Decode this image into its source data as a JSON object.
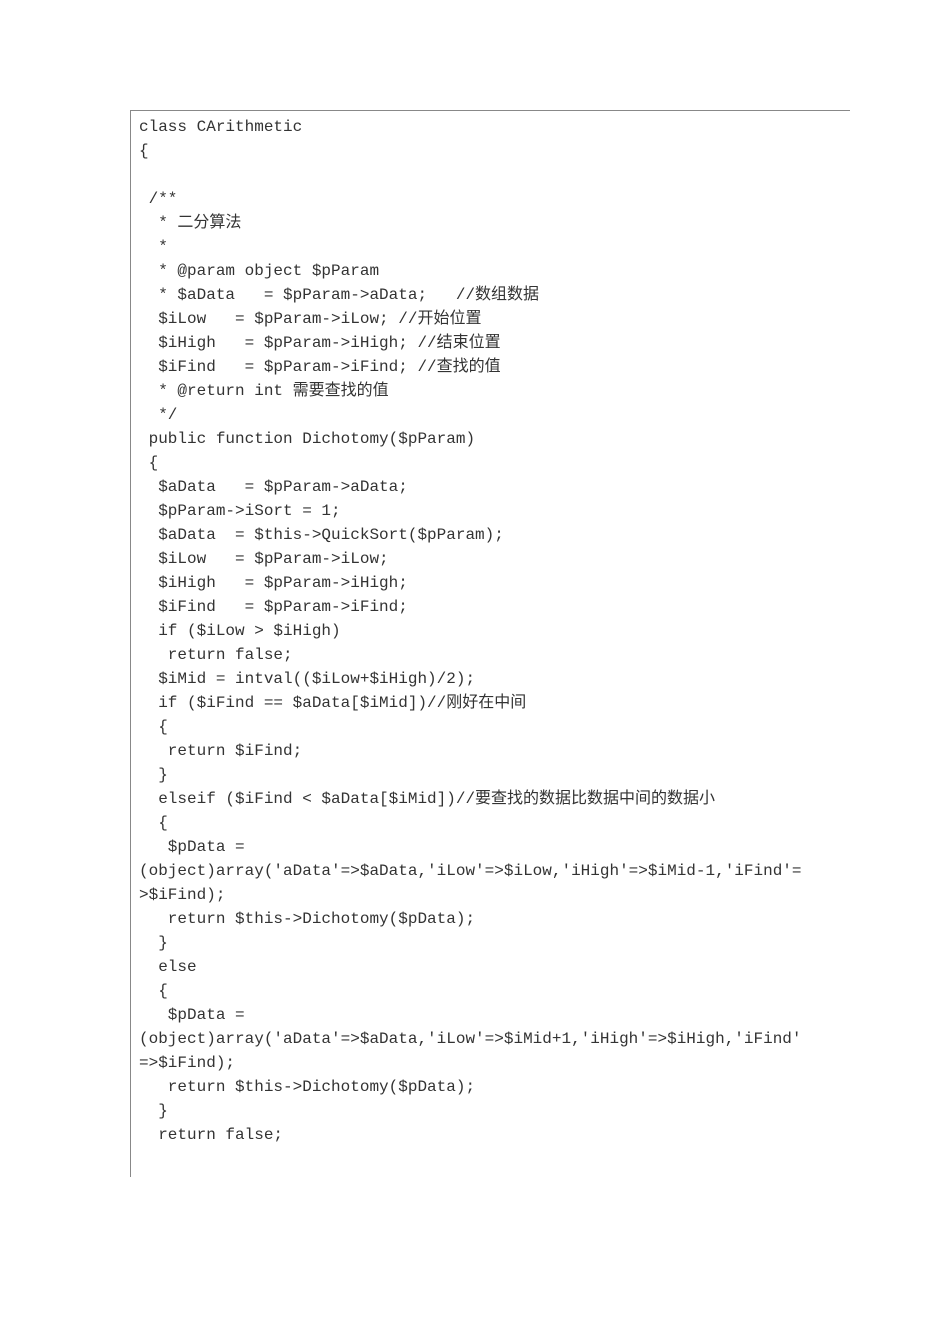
{
  "code_lines": [
    "class CArithmetic",
    "{",
    "",
    " /**",
    "  * 二分算法",
    "  *",
    "  * @param object $pParam",
    "  * $aData   = $pParam->aData;   //数组数据",
    "  $iLow   = $pParam->iLow; //开始位置",
    "  $iHigh   = $pParam->iHigh; //结束位置",
    "  $iFind   = $pParam->iFind; //查找的值",
    "  * @return int 需要查找的值",
    "  */",
    " public function Dichotomy($pParam)",
    " {",
    "  $aData   = $pParam->aData;",
    "  $pParam->iSort = 1;",
    "  $aData  = $this->QuickSort($pParam);",
    "  $iLow   = $pParam->iLow;",
    "  $iHigh   = $pParam->iHigh;",
    "  $iFind   = $pParam->iFind;",
    "  if ($iLow > $iHigh)",
    "   return false;",
    "  $iMid = intval(($iLow+$iHigh)/2);",
    "  if ($iFind == $aData[$iMid])//刚好在中间",
    "  {",
    "   return $iFind;",
    "  }",
    "  elseif ($iFind < $aData[$iMid])//要查找的数据比数据中间的数据小",
    "  {",
    "   $pData =",
    "(object)array('aData'=>$aData,'iLow'=>$iLow,'iHigh'=>$iMid-1,'iFind'=",
    ">$iFind);",
    "   return $this->Dichotomy($pData);",
    "  }",
    "  else",
    "  {",
    "   $pData =",
    "(object)array('aData'=>$aData,'iLow'=>$iMid+1,'iHigh'=>$iHigh,'iFind'",
    "=>$iFind);",
    "   return $this->Dichotomy($pData);",
    "  }",
    "  return false;"
  ]
}
